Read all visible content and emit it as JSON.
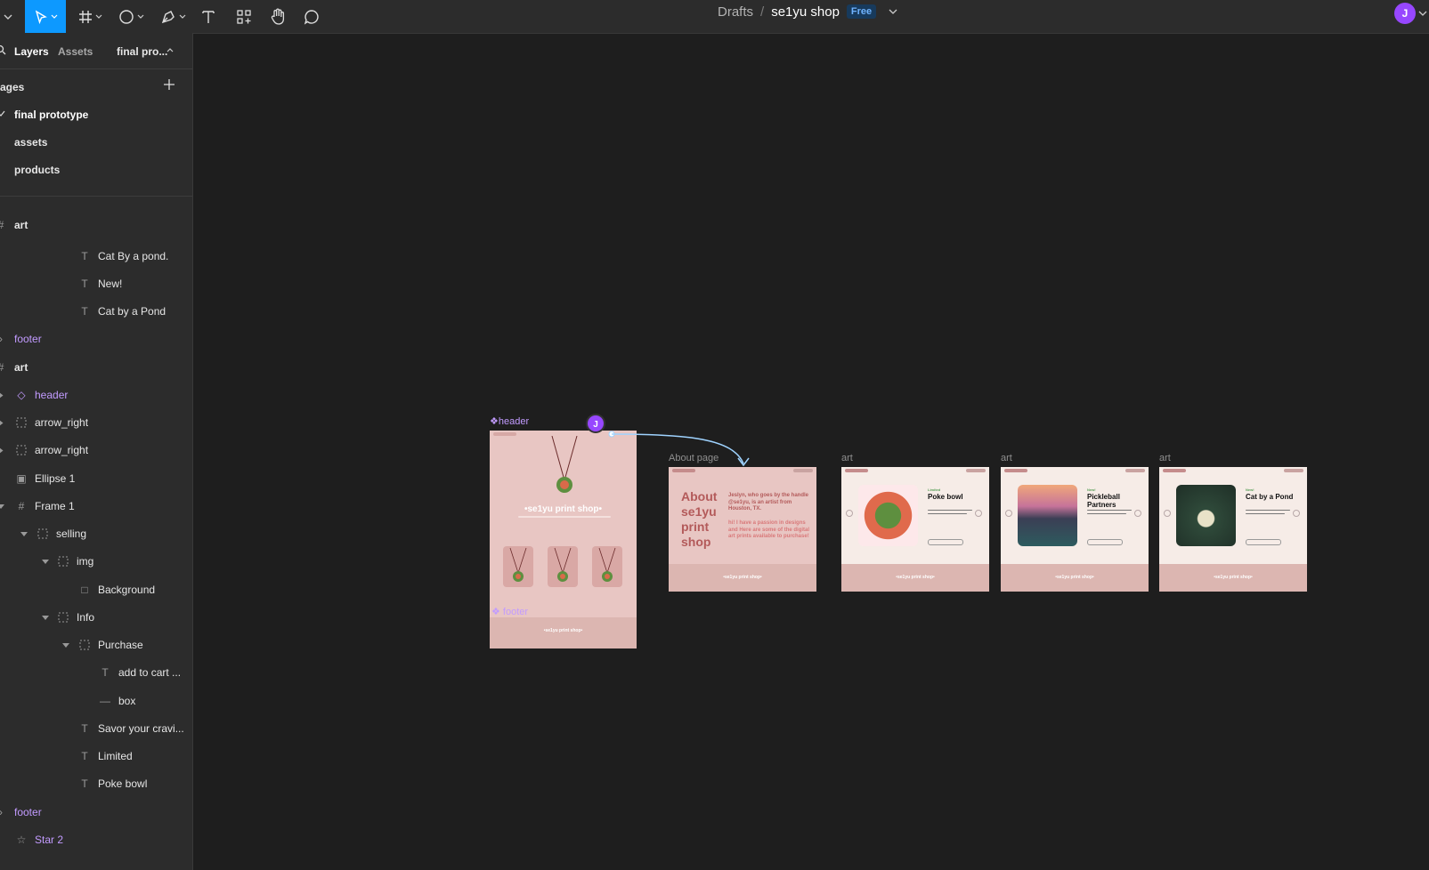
{
  "toolbar": {
    "tools": [
      "move-tool",
      "frame-tool",
      "shape-tool",
      "pen-tool",
      "text-tool",
      "resources-tool",
      "hand-tool",
      "comment-tool"
    ]
  },
  "breadcrumb": {
    "folder": "Drafts",
    "file": "se1yu shop",
    "plan": "Free"
  },
  "user": {
    "initial": "J",
    "color": "#9747ff"
  },
  "panel": {
    "tabs": {
      "layers": "Layers",
      "assets": "Assets",
      "page": "final pro..."
    },
    "pages_header": "ages",
    "pages": [
      "final prototype",
      "assets",
      "products"
    ],
    "layers": [
      {
        "label": "art",
        "kind": "frame"
      },
      {
        "label": "Cat By a pond.",
        "kind": "text"
      },
      {
        "label": "New!",
        "kind": "text"
      },
      {
        "label": "Cat by a Pond",
        "kind": "text"
      },
      {
        "label": "footer",
        "kind": "instance"
      },
      {
        "label": "art",
        "kind": "frame"
      },
      {
        "label": "header",
        "kind": "instance"
      },
      {
        "label": "arrow_right",
        "kind": "group"
      },
      {
        "label": "arrow_right",
        "kind": "group"
      },
      {
        "label": "Ellipse 1",
        "kind": "image"
      },
      {
        "label": "Frame 1",
        "kind": "frame"
      },
      {
        "label": "selling",
        "kind": "group"
      },
      {
        "label": "img",
        "kind": "group"
      },
      {
        "label": "Background",
        "kind": "rect"
      },
      {
        "label": "Info",
        "kind": "group"
      },
      {
        "label": "Purchase",
        "kind": "group"
      },
      {
        "label": "add to cart ...",
        "kind": "text"
      },
      {
        "label": "box",
        "kind": "line"
      },
      {
        "label": "Savor your cravi...",
        "kind": "text"
      },
      {
        "label": "Limited",
        "kind": "text"
      },
      {
        "label": "Poke bowl",
        "kind": "text"
      },
      {
        "label": "footer",
        "kind": "instance"
      },
      {
        "label": "Star 2",
        "kind": "star"
      }
    ]
  },
  "canvas": {
    "home_labels": {
      "header": "header",
      "footer": "footer",
      "shop_title": "•se1yu print shop•"
    },
    "about": {
      "label": "About page",
      "heading": "About se1yu print shop",
      "intro": "Jeslyn, who goes by the handle @se1yu, is an artist from Houston, TX.",
      "body": "hi! I have a passion in designs and Here are some of the digital art prints available to purchase!"
    },
    "art_label": "art",
    "products": [
      {
        "name": "Poke bowl",
        "tag": "Limited"
      },
      {
        "name": "Pickleball Partners",
        "tag": "New!"
      },
      {
        "name": "Cat by a Pond",
        "tag": "New!"
      }
    ],
    "footer_text": "•se1yu print shop•",
    "colors": {
      "frame_pink": "#e8c6c3",
      "footer_pink": "#dcb6b1",
      "text_rose": "#b35a5a",
      "selection_blue": "#9fd3ff",
      "component_purple": "#c29bff"
    }
  }
}
